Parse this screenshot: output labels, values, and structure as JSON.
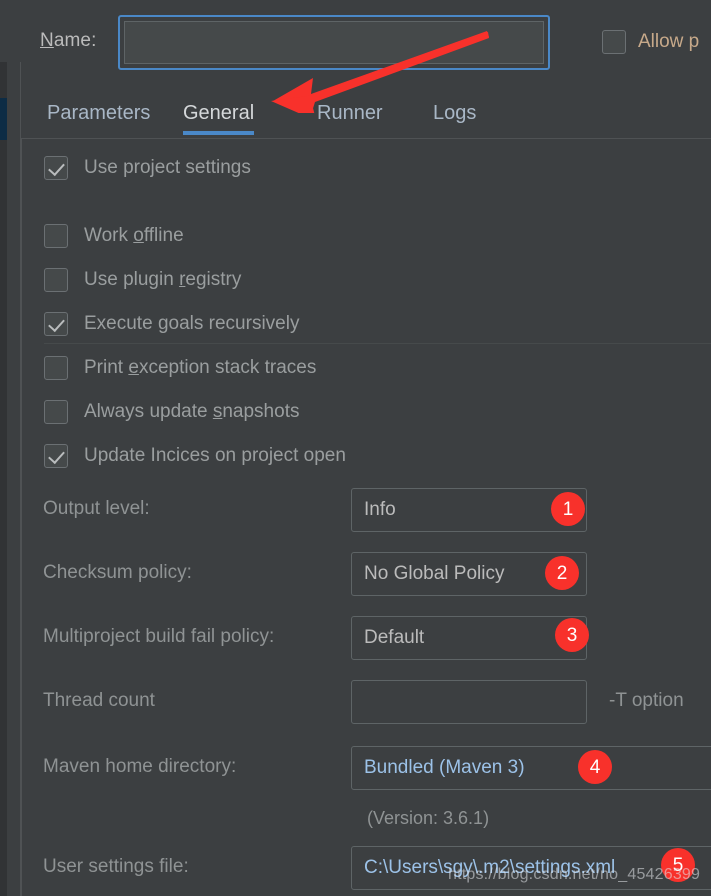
{
  "window": {
    "background_color": "#3c3f41",
    "accent_color": "#4a88c7",
    "badge_color": "#f8312b"
  },
  "name_row": {
    "label": "Name:",
    "label_mnemonic": "N",
    "input_value": "",
    "input_placeholder": "",
    "allow_checkbox": {
      "label": "Allow p",
      "checked": false
    }
  },
  "tabs": [
    {
      "label": "Parameters",
      "active": false
    },
    {
      "label": "General",
      "active": true
    },
    {
      "label": "Runner",
      "active": false
    },
    {
      "label": "Logs",
      "active": false
    }
  ],
  "checkboxes": [
    {
      "label": "Use project settings",
      "checked": true,
      "mnemonic": ""
    },
    {
      "label": "Work offline",
      "checked": false,
      "mnemonic": "o"
    },
    {
      "label": "Use plugin registry",
      "checked": false,
      "mnemonic": "r"
    },
    {
      "label": "Execute goals recursively",
      "checked": true,
      "mnemonic": "g"
    },
    {
      "label": "Print exception stack traces",
      "checked": false,
      "mnemonic": "e"
    },
    {
      "label": "Always update snapshots",
      "checked": false,
      "mnemonic": "s"
    },
    {
      "label": "Update Incices on project open",
      "checked": true,
      "mnemonic": ""
    }
  ],
  "fields": [
    {
      "label": "Output level:",
      "value": "Info",
      "badge": "1"
    },
    {
      "label": "Checksum policy:",
      "value": "No Global Policy",
      "badge": "2"
    },
    {
      "label": "Multiproject build fail policy:",
      "value": "Default",
      "badge": "3"
    },
    {
      "label": "Thread count",
      "value": "",
      "suffix": "-T option",
      "badge": ""
    },
    {
      "label": "Maven home directory:",
      "value": "Bundled (Maven 3)",
      "badge": "4",
      "note": "(Version: 3.6.1)"
    },
    {
      "label": "User settings file:",
      "value": "C:\\Users\\sgy\\.m2\\settings.xml",
      "badge": "5"
    }
  ],
  "watermark": "https://blog.csdn.net/no_45426399"
}
